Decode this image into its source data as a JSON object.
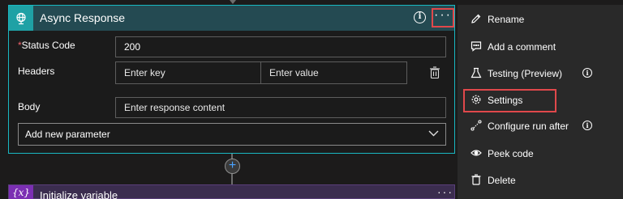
{
  "card": {
    "title": "Async Response",
    "info_glyph": "i",
    "more_glyph": "···",
    "status_code_label": "Status Code",
    "status_code_value": "200",
    "headers_label": "Headers",
    "key_placeholder": "Enter key",
    "value_placeholder": "Enter value",
    "body_label": "Body",
    "body_placeholder": "Enter response content",
    "add_parameter": "Add new parameter"
  },
  "next_card": {
    "icon_text": "{x}",
    "title": "Initialize variable",
    "more_glyph": "···"
  },
  "connector": {
    "plus_glyph": "+"
  },
  "menu": {
    "items": [
      {
        "label": "Rename",
        "icon": "pencil-icon",
        "info": false
      },
      {
        "label": "Add a comment",
        "icon": "comment-icon",
        "info": false
      },
      {
        "label": "Testing (Preview)",
        "icon": "flask-icon",
        "info": true
      },
      {
        "label": "Settings",
        "icon": "gear-icon",
        "info": false
      },
      {
        "label": "Configure run after",
        "icon": "run-after-icon",
        "info": true
      },
      {
        "label": "Peek code",
        "icon": "eye-icon",
        "info": false
      },
      {
        "label": "Delete",
        "icon": "trash-icon",
        "info": false
      }
    ],
    "info_glyph": "i"
  },
  "colors": {
    "accent": "#19b8c2",
    "header_bg": "#244a52",
    "highlight": "#e0484b",
    "menu_bg": "#292929"
  }
}
